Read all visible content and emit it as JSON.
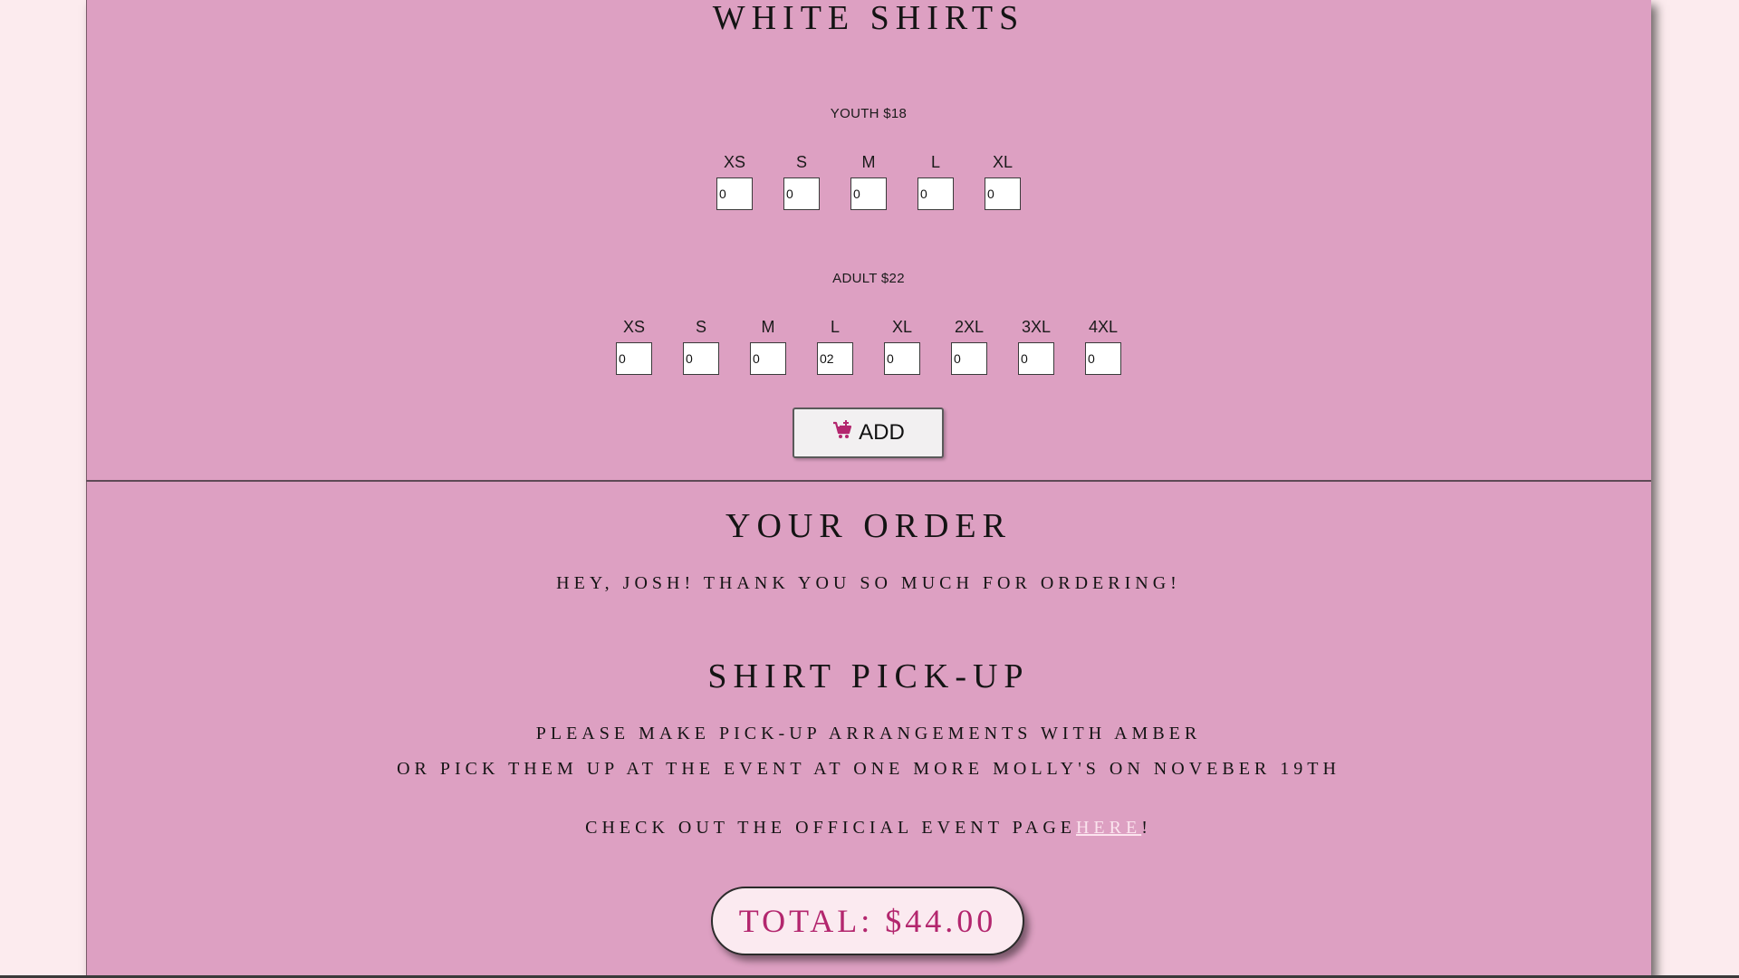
{
  "white_shirts": {
    "title": "WHITE SHIRTS",
    "youth": {
      "label": "YOUTH $18",
      "sizes": [
        {
          "size": "XS",
          "value": "0"
        },
        {
          "size": "S",
          "value": "0"
        },
        {
          "size": "M",
          "value": "0"
        },
        {
          "size": "L",
          "value": "0"
        },
        {
          "size": "XL",
          "value": "0"
        }
      ]
    },
    "adult": {
      "label": "ADULT $22",
      "sizes": [
        {
          "size": "XS",
          "value": "0"
        },
        {
          "size": "S",
          "value": "0"
        },
        {
          "size": "M",
          "value": "0"
        },
        {
          "size": "L",
          "value": "02"
        },
        {
          "size": "XL",
          "value": "0"
        },
        {
          "size": "2XL",
          "value": "0"
        },
        {
          "size": "3XL",
          "value": "0"
        },
        {
          "size": "4XL",
          "value": "0"
        }
      ]
    },
    "add_button": {
      "label": "ADD",
      "icon": "cart-plus-icon"
    }
  },
  "order": {
    "title": "YOUR ORDER",
    "greeting": "HEY, JOSH! THANK YOU SO MUCH FOR ORDERING!"
  },
  "pickup": {
    "title": "SHIRT PICK-UP",
    "line1": "PLEASE MAKE PICK-UP ARRANGEMENTS WITH AMBER",
    "line2": "OR PICK THEM UP AT THE EVENT AT ONE MORE MOLLY'S ON NOVEBER 19TH",
    "event_text": "CHECK OUT THE OFFICIAL EVENT PAGE",
    "event_link": "HERE",
    "event_suffix": "!"
  },
  "total": {
    "label": "TOTAL: $44.00"
  },
  "colors": {
    "background": "#fcebee",
    "panel": "#dda0c2",
    "accent": "#b3266e",
    "link": "#fbe4ee"
  }
}
